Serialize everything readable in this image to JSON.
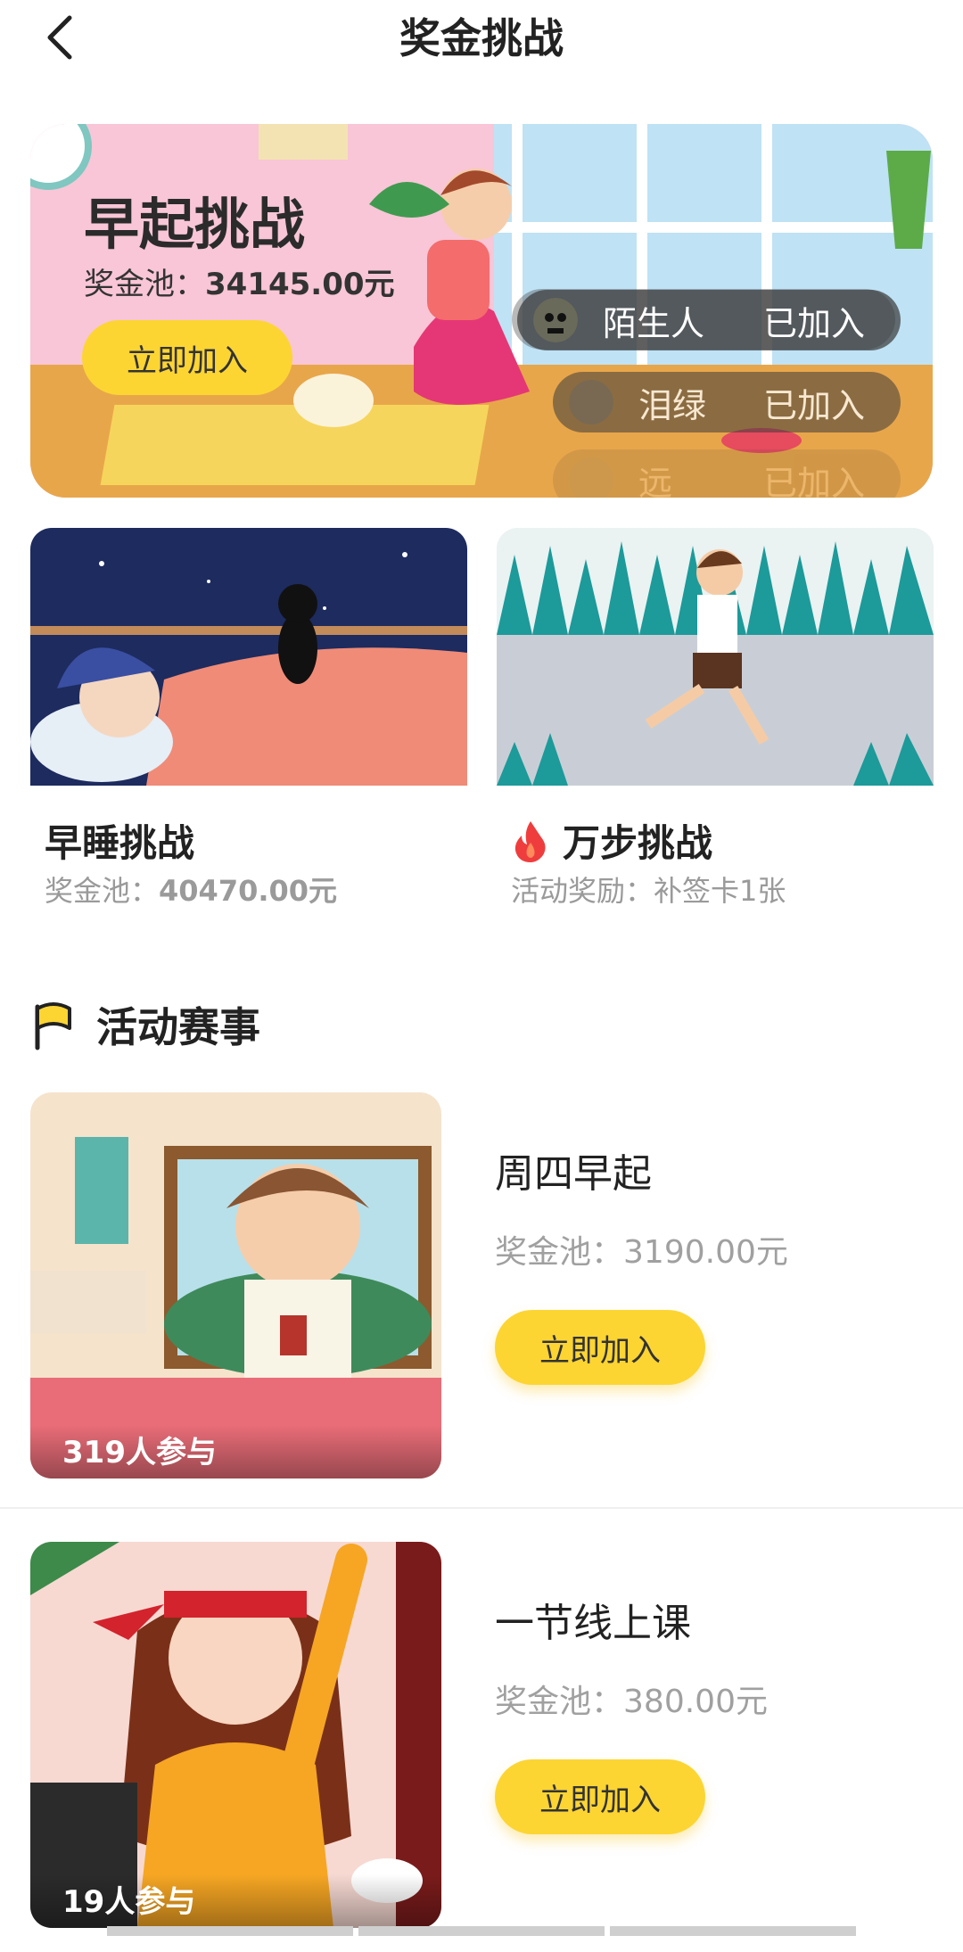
{
  "header": {
    "title": "奖金挑战",
    "back_icon": "chevron-left-icon"
  },
  "hero": {
    "title": "早起挑战",
    "pool_label": "奖金池：",
    "pool_value": "34145.00元",
    "join_label": "立即加入",
    "participants": [
      {
        "name": "陌生人",
        "status": "已加入"
      },
      {
        "name": "泪绿",
        "status": "已加入"
      },
      {
        "name": "远",
        "status": "已加入"
      }
    ]
  },
  "cards": [
    {
      "title": "早睡挑战",
      "sub_label": "奖金池：",
      "sub_value": "40470.00元",
      "icon": ""
    },
    {
      "title": "万步挑战",
      "sub_label": "活动奖励：",
      "sub_value": "补签卡1张",
      "icon": "fire-icon"
    }
  ],
  "section": {
    "title": "活动赛事",
    "icon": "flag-icon"
  },
  "events": [
    {
      "title": "周四早起",
      "pool_label": "奖金池：",
      "pool_value": "3190.00元",
      "join_label": "立即加入",
      "participants": "319人参与"
    },
    {
      "title": "一节线上课",
      "pool_label": "奖金池：",
      "pool_value": "380.00元",
      "join_label": "立即加入",
      "participants": "19人参与"
    }
  ],
  "colors": {
    "accent": "#fcd533",
    "muted": "#9a9a9a"
  }
}
